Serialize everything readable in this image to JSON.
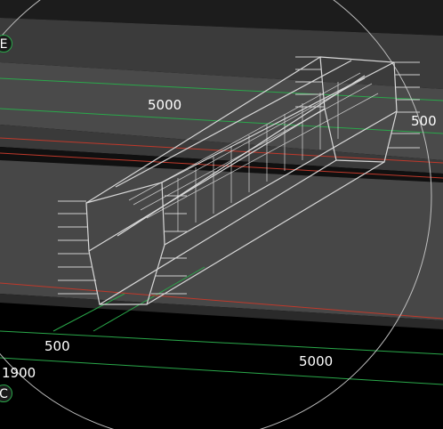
{
  "viewport": {
    "dimensions": {
      "top_span": "5000",
      "right_width": "500",
      "left_width": "500",
      "left_offset": "1900",
      "bottom_span": "5000"
    },
    "grid_bubbles": {
      "top_left": "E",
      "bottom_left": "C"
    },
    "colors": {
      "background": "#000000",
      "slab_top": "#3a3a3a",
      "slab_mid": "#474747",
      "grid_line": "#2aa84a",
      "red_line": "#c0392b",
      "wireframe": "#d9d9d9",
      "nav_circle": "#bfbfbf"
    }
  }
}
